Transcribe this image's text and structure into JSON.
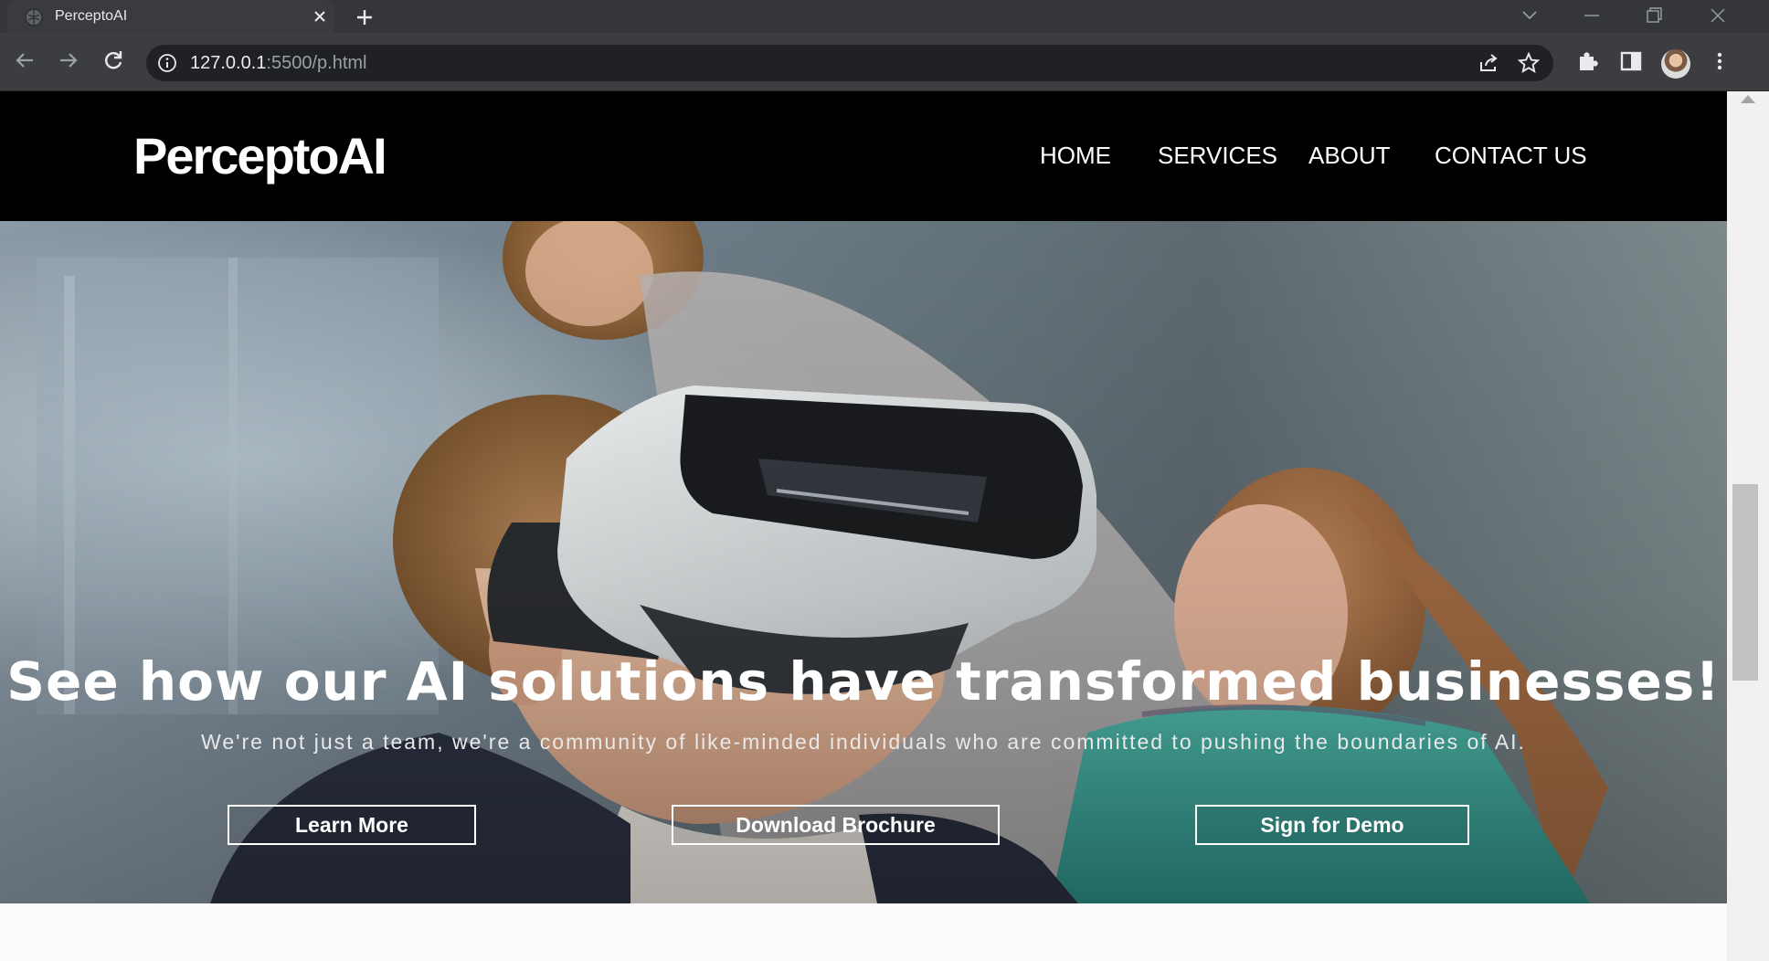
{
  "browser": {
    "tab_title": "PerceptoAI",
    "url_host": "127.0.0.1",
    "url_rest": ":5500/p.html"
  },
  "site": {
    "logo": "PerceptoAI",
    "nav": [
      "HOME",
      "SERVICES",
      "ABOUT",
      "CONTACT US"
    ]
  },
  "hero": {
    "title": "See how our AI solutions have transformed businesses!",
    "subtitle": "We're not just a team, we're a community of like-minded individuals who are committed to pushing the boundaries of AI.",
    "buttons": [
      "Learn More",
      "Download Brochure",
      "Sign for Demo"
    ]
  }
}
